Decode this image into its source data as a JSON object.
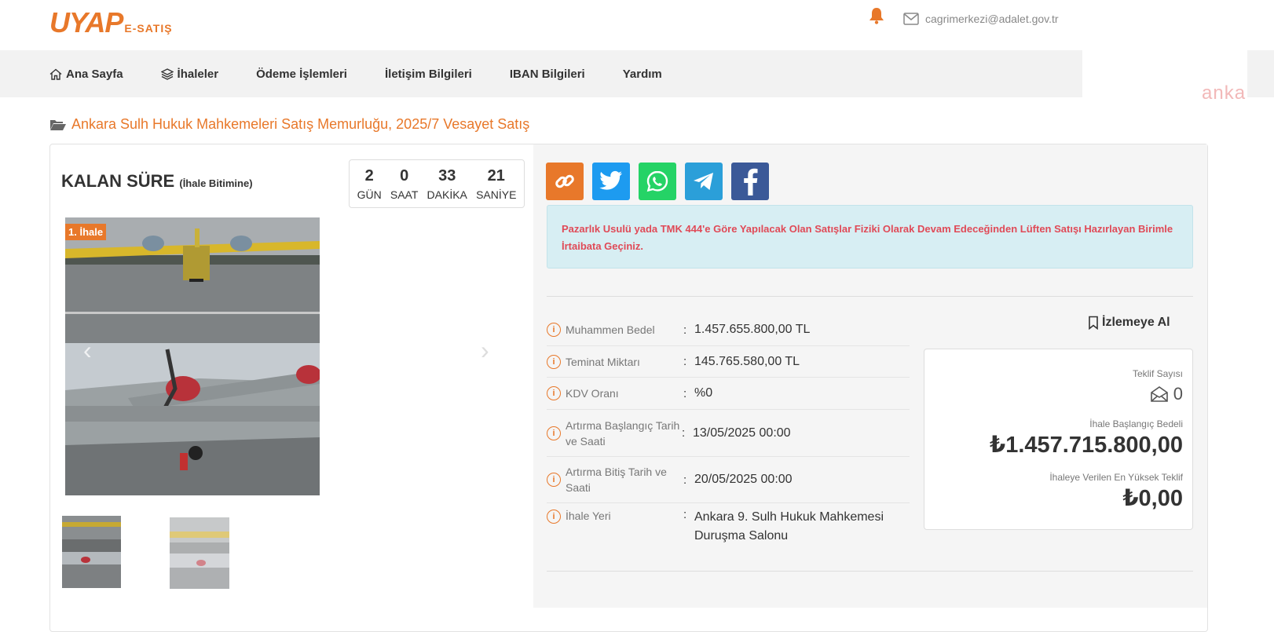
{
  "header": {
    "logo_main": "UYAP",
    "logo_sub": "E-SATIŞ",
    "email": "cagrimerkezi@adalet.gov.tr",
    "watermark": "anka"
  },
  "nav": {
    "items": [
      {
        "label": "Ana Sayfa",
        "icon": "home-icon"
      },
      {
        "label": "İhaleler",
        "icon": "layers-icon"
      },
      {
        "label": "Ödeme İşlemleri"
      },
      {
        "label": "İletişim Bilgileri"
      },
      {
        "label": "IBAN Bilgileri"
      },
      {
        "label": "Yardım"
      }
    ]
  },
  "breadcrumb": "Ankara Sulh Hukuk Mahkemeleri Satış Memurluğu, 2025/7 Vesayet Satış",
  "countdown": {
    "title": "KALAN SÜRE",
    "subtitle": "(İhale Bitimine)",
    "cells": [
      {
        "value": "2",
        "label": "GÜN"
      },
      {
        "value": "0",
        "label": "SAAT"
      },
      {
        "value": "33",
        "label": "DAKİKA"
      },
      {
        "value": "21",
        "label": "SANİYE"
      }
    ]
  },
  "gallery": {
    "badge": "1. İhale",
    "prev": "‹",
    "next": "›"
  },
  "alert": "Pazarlık Usulü yada TMK 444'e Göre Yapılacak Olan Satışlar Fiziki Olarak Devam Edeceğinden Lüften Satışı Hazırlayan Birimle İrtaibata Geçiniz.",
  "details": [
    {
      "label": "Muhammen Bedel",
      "value": "1.457.655.800,00 TL"
    },
    {
      "label": "Teminat Miktarı",
      "value": "145.765.580,00 TL"
    },
    {
      "label": "KDV Oranı",
      "value": "%0"
    },
    {
      "label": "Artırma Başlangıç Tarih ve Saati",
      "value": "13/05/2025 00:00"
    },
    {
      "label": "Artırma Bitiş Tarih ve Saati",
      "value": "20/05/2025 00:00"
    },
    {
      "label": "İhale Yeri",
      "value": "Ankara 9. Sulh Hukuk Mahkemesi Duruşma Salonu"
    }
  ],
  "watch_label": "İzlemeye Al",
  "bid": {
    "count_label": "Teklif Sayısı",
    "count": "0",
    "start_label": "İhale Başlangıç Bedeli",
    "start_value": "₺1.457.715.800,00",
    "highest_label": "İhaleye Verilen En Yüksek Teklif",
    "highest_value": "₺0,00"
  },
  "colors": {
    "accent": "#e8782a",
    "alert_text": "#e04a57",
    "alert_bg": "#d7eef3"
  }
}
